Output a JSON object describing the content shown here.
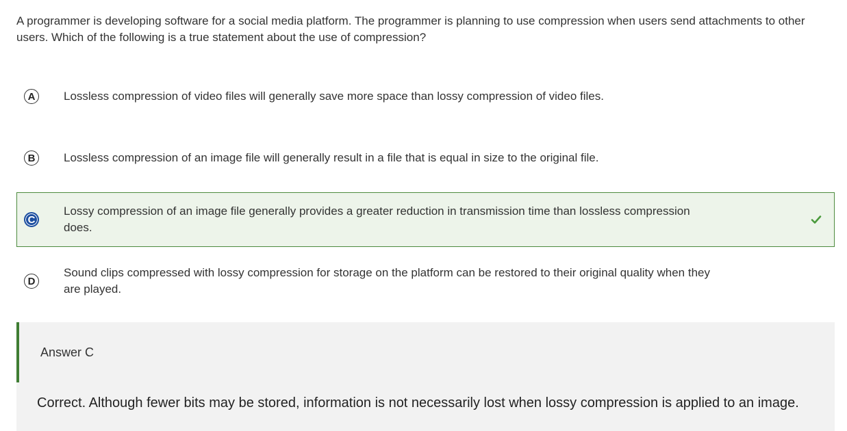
{
  "question": {
    "text": "A programmer is developing software for a social media platform. The programmer is planning to use compression when users send attachments to other users. Which of the following is a true statement about the use of compression?"
  },
  "choices": [
    {
      "letter": "A",
      "text": "Lossless compression of video files will generally save more space than lossy compression of video files.",
      "selected": false,
      "correct": false
    },
    {
      "letter": "B",
      "text": "Lossless compression of an image file will generally result in a file that is equal in size to the original file.",
      "selected": false,
      "correct": false
    },
    {
      "letter": "C",
      "text": "Lossy compression of an image file generally provides a greater reduction in transmission time than lossless compression does.",
      "selected": true,
      "correct": true
    },
    {
      "letter": "D",
      "text": "Sound clips compressed with lossy compression for storage on the platform can be restored to their original quality when they are played.",
      "selected": false,
      "correct": false
    }
  ],
  "answer": {
    "title": "Answer C",
    "explanation": "Correct. Although fewer bits may be stored, information is not necessarily lost when lossy compression is applied to an image."
  },
  "icons": {
    "correct": "check-icon"
  },
  "colors": {
    "correct_border": "#4c8a3d",
    "correct_background": "#edf4ea",
    "selected_letter": "#1d4fa0",
    "check": "#4a9a3c",
    "answer_bar": "#3f7d33",
    "answer_background": "#f2f2f2"
  }
}
